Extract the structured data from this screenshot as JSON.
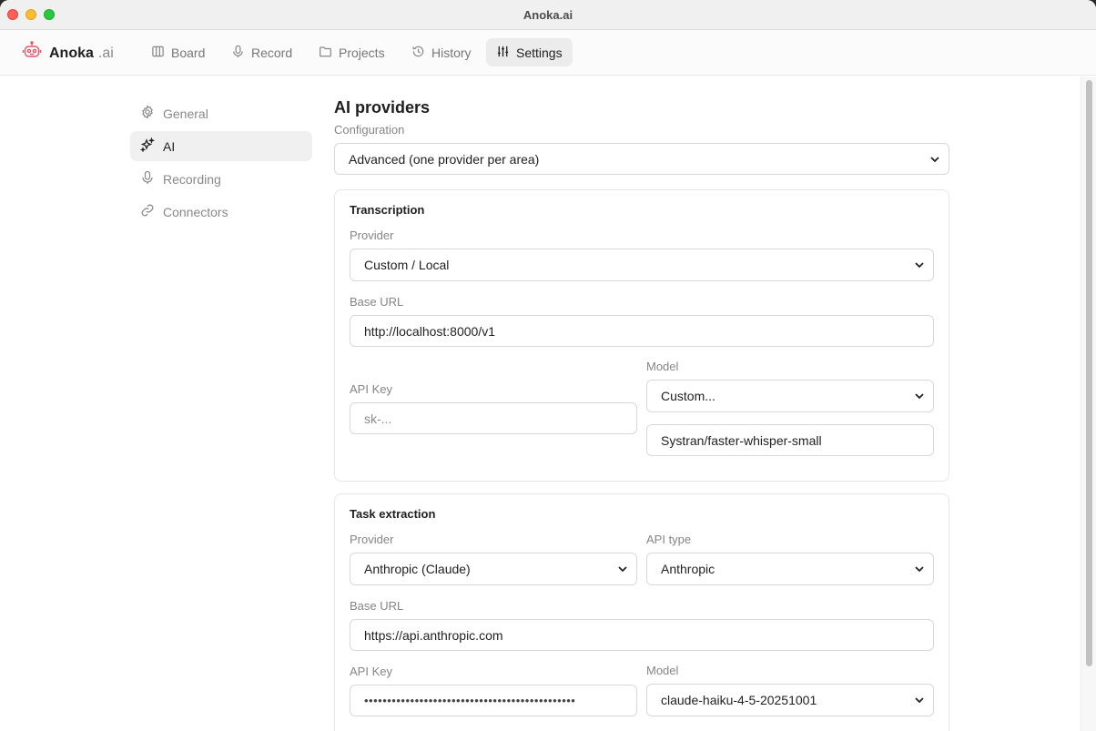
{
  "window": {
    "title": "Anoka.ai"
  },
  "brand": {
    "name": "Anoka",
    "suffix": ".ai"
  },
  "nav": {
    "board": "Board",
    "record": "Record",
    "projects": "Projects",
    "history": "History",
    "settings": "Settings"
  },
  "sidebar": {
    "items": [
      {
        "label": "General",
        "icon": "gear-icon"
      },
      {
        "label": "AI",
        "icon": "sparkle-icon"
      },
      {
        "label": "Recording",
        "icon": "microphone-icon"
      },
      {
        "label": "Connectors",
        "icon": "link-icon"
      }
    ],
    "active": "AI"
  },
  "page": {
    "title": "AI providers",
    "configuration_label": "Configuration",
    "configuration_value": "Advanced (one provider per area)"
  },
  "transcription": {
    "title": "Transcription",
    "provider_label": "Provider",
    "provider_value": "Custom / Local",
    "base_url_label": "Base URL",
    "base_url_value": "http://localhost:8000/v1",
    "api_key_label": "API Key",
    "api_key_placeholder": "sk-...",
    "model_label": "Model",
    "model_value": "Custom...",
    "custom_model_value": "Systran/faster-whisper-small"
  },
  "task_extraction": {
    "title": "Task extraction",
    "provider_label": "Provider",
    "provider_value": "Anthropic (Claude)",
    "api_type_label": "API type",
    "api_type_value": "Anthropic",
    "base_url_label": "Base URL",
    "base_url_value": "https://api.anthropic.com",
    "api_key_label": "API Key",
    "api_key_masked": "••••••••••••••••••••••••••••••••••••••••••••••",
    "model_label": "Model",
    "model_value": "claude-haiku-4-5-20251001"
  },
  "colors": {
    "accent_logo": "#e0566c",
    "active_bg": "#ececec",
    "text_muted": "#858585"
  }
}
